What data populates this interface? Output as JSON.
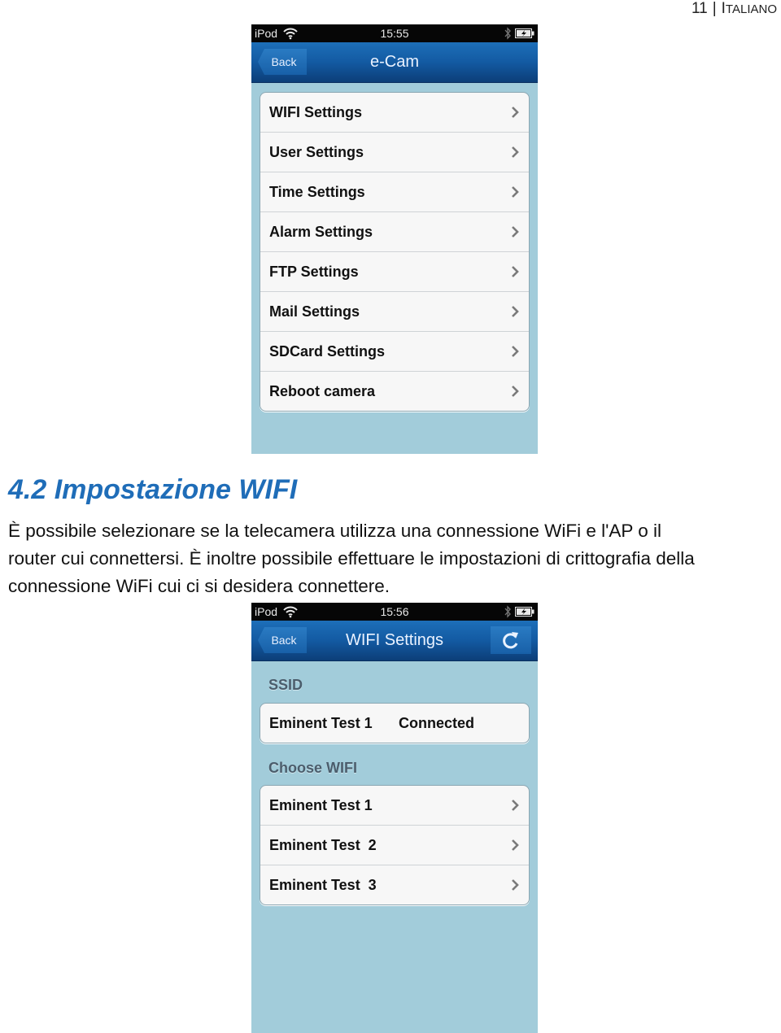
{
  "page_header": {
    "page_number": "11",
    "language_first": "I",
    "language_rest": "TALIANO"
  },
  "screen1": {
    "statusbar": {
      "carrier": "iPod",
      "time": "15:55"
    },
    "navbar": {
      "back_label": "Back",
      "title": "e-Cam"
    },
    "menu": [
      {
        "label": "WIFI Settings"
      },
      {
        "label": "User Settings"
      },
      {
        "label": "Time Settings"
      },
      {
        "label": "Alarm Settings"
      },
      {
        "label": "FTP Settings"
      },
      {
        "label": "Mail Settings"
      },
      {
        "label": "SDCard Settings"
      },
      {
        "label": "Reboot camera"
      }
    ]
  },
  "section": {
    "heading": "4.2 Impostazione WIFI",
    "paragraph_lines": [
      "È possibile selezionare se la telecamera utilizza una connessione WiFi e l'AP o il",
      "router cui connettersi. È inoltre possibile effettuare le impostazioni di crittografia della",
      "connessione WiFi cui ci si desidera connettere."
    ]
  },
  "screen2": {
    "statusbar": {
      "carrier": "iPod",
      "time": "15:56"
    },
    "navbar": {
      "back_label": "Back",
      "title": "WIFI Settings",
      "refresh_icon": "refresh-icon"
    },
    "ssid_label": "SSID",
    "current": {
      "ssid": "Eminent Test 1",
      "status": "Connected"
    },
    "choose_label": "Choose WIFI",
    "networks": [
      {
        "label": "Eminent Test 1"
      },
      {
        "label": "Eminent Test  2"
      },
      {
        "label": "Eminent Test  3"
      }
    ]
  },
  "colors": {
    "heading_blue": "#1f6db8",
    "navbar_blue": "#135aa2",
    "screen_background": "#a2ccda",
    "cell_background": "#f7f7f7"
  }
}
